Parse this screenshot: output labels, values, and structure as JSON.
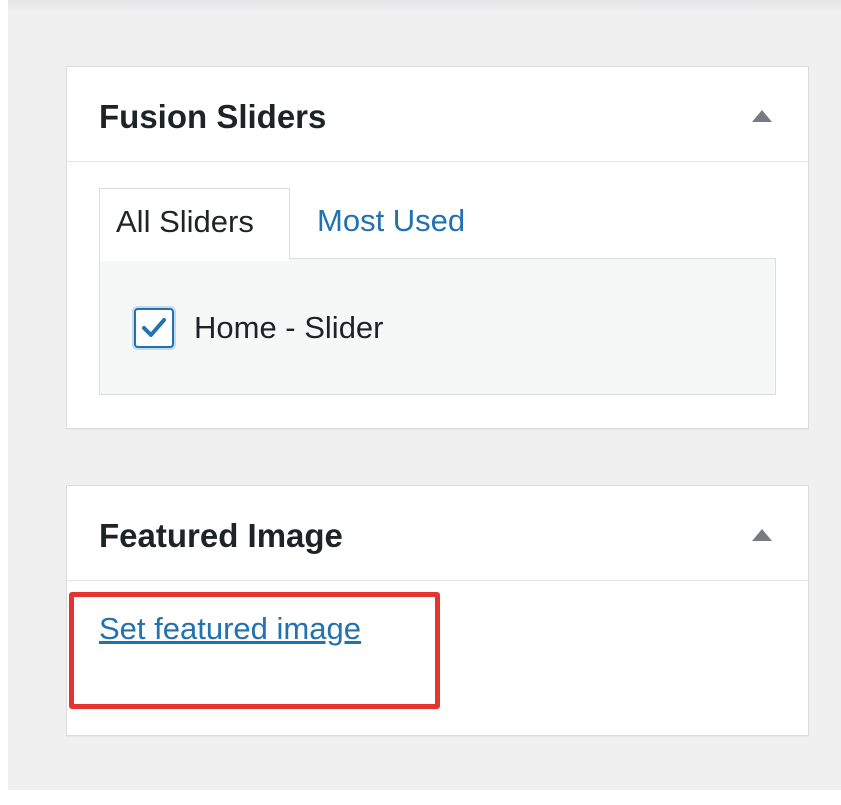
{
  "fusion_sliders": {
    "title": "Fusion Sliders",
    "tabs": [
      {
        "label": "All Sliders",
        "active": true
      },
      {
        "label": "Most Used",
        "active": false
      }
    ],
    "items": [
      {
        "label": "Home - Slider",
        "checked": true
      }
    ]
  },
  "featured_image": {
    "title": "Featured Image",
    "link_label": "Set featured image"
  },
  "colors": {
    "link": "#2271b1",
    "highlight": "#e3342f",
    "background": "#f0f0f1"
  },
  "icons": {
    "collapse": "triangle-up-icon",
    "check": "checkmark-icon"
  }
}
